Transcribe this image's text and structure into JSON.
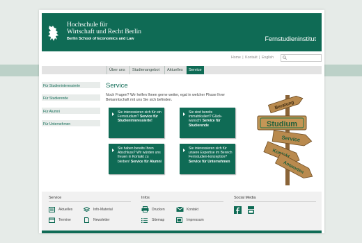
{
  "header": {
    "university_line1": "Hochschule für",
    "university_line2": "Wirtschaft und Recht Berlin",
    "university_line3": "Berlin School of Economics and Law",
    "site_title": "Fernstudieninstitut",
    "logo_icon": "bear-icon"
  },
  "utility": {
    "home": "Home",
    "kontakt": "Kontakt",
    "english": "English",
    "separator": "|",
    "search_icon": "search-icon"
  },
  "nav": [
    {
      "label": "Über uns"
    },
    {
      "label": "Studienangebot"
    },
    {
      "label": "Aktuelles"
    },
    {
      "label": "Service",
      "active": true
    }
  ],
  "sidebar": [
    {
      "label": "Für Studieninteressierte"
    },
    {
      "label": "Für Studierende"
    },
    {
      "label": "Für Alumni"
    },
    {
      "label": "Für Unternehmen"
    }
  ],
  "content": {
    "title": "Service",
    "intro": "Noch Fragen? Wir helfen Ihnen gerne weiter, egal in welcher Phase Ihrer Bekanntschaft mit uns Sie sich befinden.",
    "tiles": [
      {
        "text": "Sie interessieren sich für ein Fernstudium?",
        "bold": "Service für Studieninteressierte!"
      },
      {
        "text": "Sie sind bereits immatrikuliert? Glück-wunsch!",
        "bold": "Service für Studierende"
      },
      {
        "text": "Sie haben bereits Ihren Abschluss? Wir würden uns freuen in Kontakt zu bleiben!",
        "bold": "Service für Alumni"
      },
      {
        "text": "Sie interessieren sich für unsere Expertise im Bereich Fernstudien-konzeption?",
        "bold": "Service für Unternehmen"
      }
    ],
    "signpost": {
      "main": "Studium",
      "arrow1": "Beratung",
      "arrow2": "Service",
      "arrow3": "Kontakt",
      "arrow4": "Antworten"
    }
  },
  "footer": {
    "service": {
      "heading": "Service",
      "links": [
        "Aktuelles",
        "Info-Material",
        "Termine",
        "Newsletter"
      ]
    },
    "infos": {
      "heading": "Infos",
      "links": [
        "Drucken",
        "Kontakt",
        "Sitemap",
        "Impressum"
      ]
    },
    "social": {
      "heading": "Social Media",
      "icons": [
        "facebook-icon",
        "youtube-icon"
      ]
    }
  },
  "colors": {
    "brand_green": "#0f6b55",
    "band": "#bcd1c8"
  }
}
